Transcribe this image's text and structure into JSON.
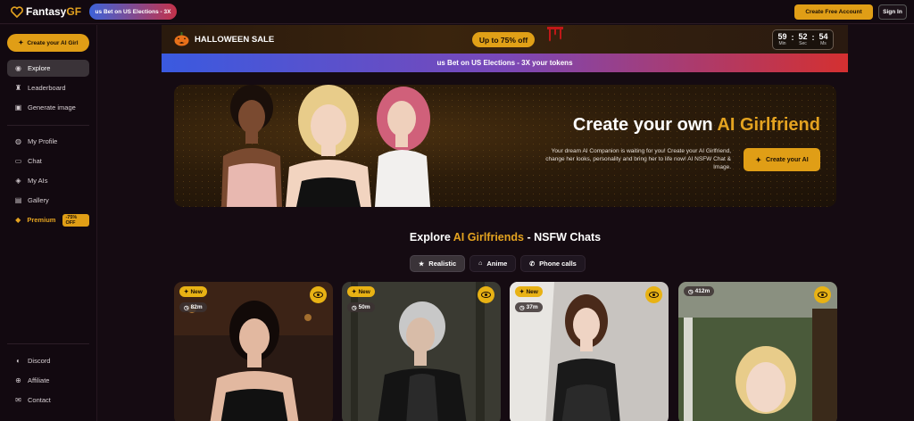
{
  "brand": {
    "name_main": "Fantasy",
    "name_accent": "GF",
    "accent_color": "#e4a320"
  },
  "topbar": {
    "election_pill": "us Bet on US Elections - 3X",
    "create_free_label": "Create Free Account",
    "signin_label": "Sign In"
  },
  "sidebar": {
    "create_label": "Create your AI Girl",
    "items_top": [
      {
        "label": "Explore",
        "icon": "compass-icon",
        "active": true
      },
      {
        "label": "Leaderboard",
        "icon": "trophy-icon"
      },
      {
        "label": "Generate image",
        "icon": "image-icon"
      }
    ],
    "items_mid": [
      {
        "label": "My Profile",
        "icon": "user-icon"
      },
      {
        "label": "Chat",
        "icon": "chat-icon"
      },
      {
        "label": "My AIs",
        "icon": "ai-icon"
      },
      {
        "label": "Gallery",
        "icon": "gallery-icon"
      }
    ],
    "premium_label": "Premium",
    "premium_badge": "-75% OFF",
    "items_bottom": [
      {
        "label": "Discord",
        "icon": "discord-icon"
      },
      {
        "label": "Affiliate",
        "icon": "affiliate-icon"
      },
      {
        "label": "Contact",
        "icon": "mail-icon"
      }
    ]
  },
  "sale": {
    "title": "HALLOWEEN SALE",
    "offer": "Up to 75% off",
    "countdown": {
      "min": "59",
      "sec": "52",
      "ms": "54",
      "min_label": "Min",
      "sec_label": "Sec",
      "ms_label": "Ms"
    }
  },
  "election_bar": "us Bet on US Elections - 3X your tokens",
  "hero": {
    "title_main": "Create your own ",
    "title_accent": "AI Girlfriend",
    "description": "Your dream AI Companion is waiting for you! Create your AI Girlfriend, change her looks, personality and bring her to life now! AI NSFW Chat & Image.",
    "button_label": "Create your AI"
  },
  "explore": {
    "title_pre": "Explore ",
    "title_accent": "AI Girlfriends",
    "title_post": " - NSFW Chats",
    "tabs": [
      {
        "label": "Realistic",
        "icon": "star-icon",
        "active": true
      },
      {
        "label": "Anime",
        "icon": "house-icon"
      },
      {
        "label": "Phone calls",
        "icon": "phone-icon"
      }
    ]
  },
  "cards": [
    {
      "new": "New",
      "time": "82m"
    },
    {
      "new": "New",
      "time": "50m"
    },
    {
      "new": "New",
      "time": "37m"
    },
    {
      "new": "",
      "time": "412m"
    }
  ]
}
